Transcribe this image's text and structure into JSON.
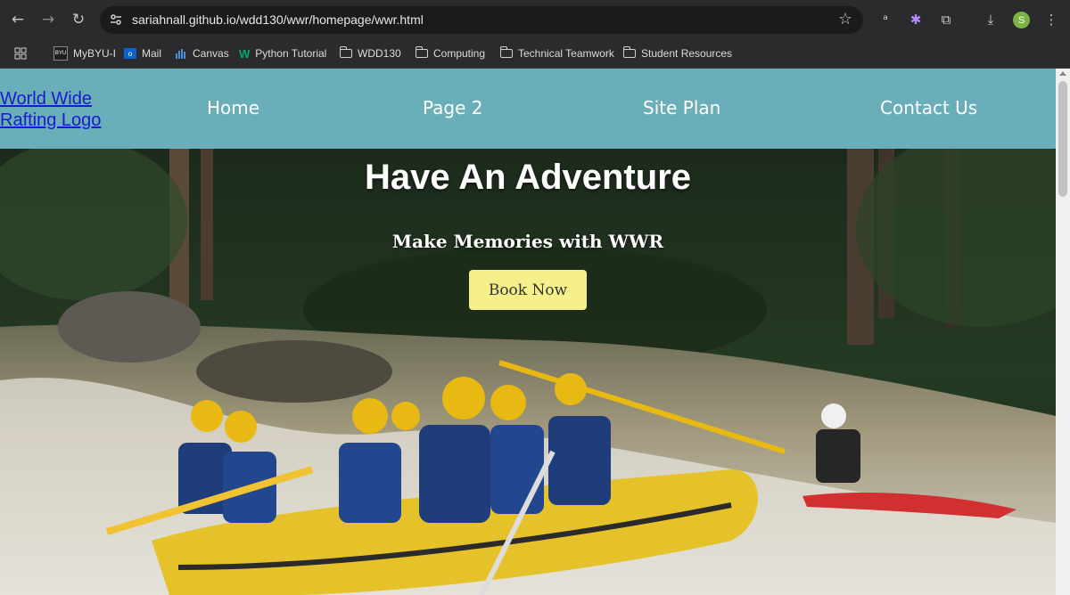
{
  "browser": {
    "url": "sariahnall.github.io/wdd130/wwr/homepage/wwr.html",
    "profile_initial": "S",
    "bookmarks": [
      {
        "label": "MyBYU-I",
        "icon": "byu-icon"
      },
      {
        "label": "Mail",
        "icon": "outlook-icon"
      },
      {
        "label": "Canvas",
        "icon": "canvas-icon"
      },
      {
        "label": "Python Tutorial",
        "icon": "w3schools-icon"
      },
      {
        "label": "WDD130",
        "icon": "folder-icon"
      },
      {
        "label": "Computing",
        "icon": "folder-icon"
      },
      {
        "label": "Technical Teamwork",
        "icon": "folder-icon"
      },
      {
        "label": "Student Resources",
        "icon": "folder-icon"
      }
    ]
  },
  "site": {
    "logo_alt": "World Wide Rafting Logo",
    "nav": [
      "Home",
      "Page 2",
      "Site Plan",
      "Contact Us"
    ],
    "header_color": "#6aaeb9"
  },
  "hero": {
    "title": "Have An Adventure",
    "subtitle": "Make Memories with WWR",
    "button": "Book Now",
    "button_color": "#f6f08a"
  }
}
